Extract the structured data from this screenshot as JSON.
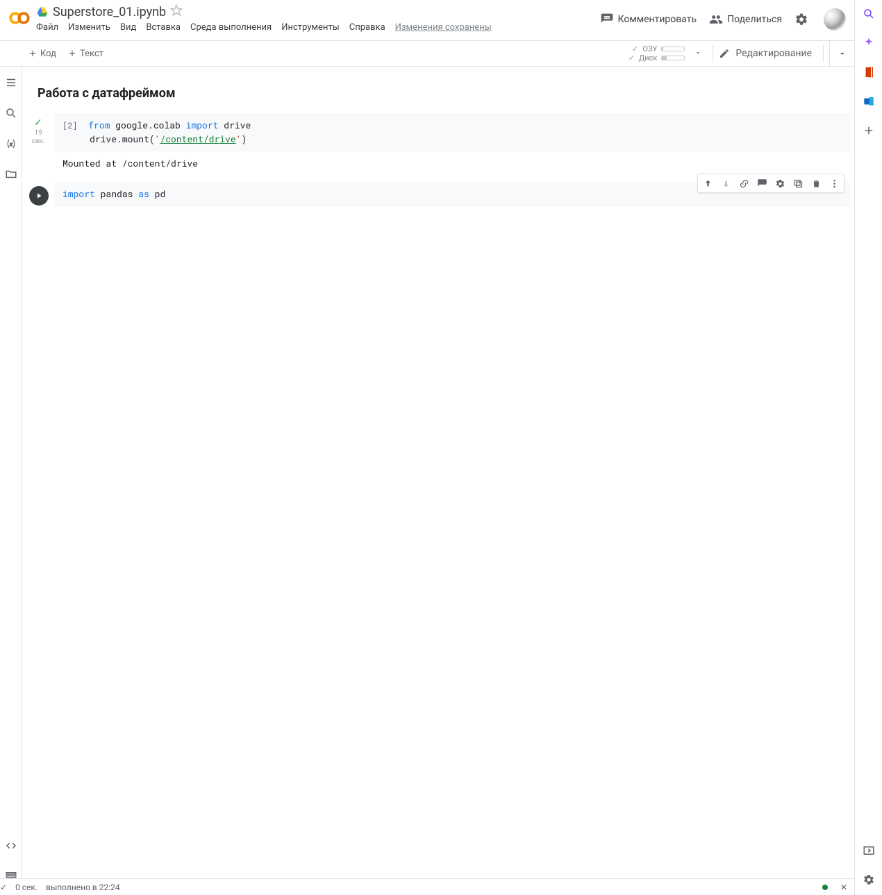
{
  "header": {
    "title": "Superstore_01.ipynb",
    "menus": [
      "Файл",
      "Изменить",
      "Вид",
      "Вставка",
      "Среда выполнения",
      "Инструменты",
      "Справка"
    ],
    "save_status": "Изменения сохранены",
    "comment_label": "Комментировать",
    "share_label": "Поделиться"
  },
  "toolbar": {
    "add_code": "Код",
    "add_text": "Текст",
    "ram_label": "ОЗУ",
    "disk_label": "Диск",
    "edit_label": "Редактирование"
  },
  "notebook": {
    "heading": "Работа с датафреймом",
    "cell1": {
      "index": "[2]",
      "exec_time": "19",
      "exec_unit": "сек.",
      "code_tokens": {
        "from_kw": "from",
        "mod": " google.colab ",
        "import_kw": "import",
        "drive": " drive",
        "line2a": "drive.mount(",
        "str_q1": "'",
        "str_body": "/content/drive",
        "str_q2": "'",
        "line2b": ")"
      },
      "output": "Mounted at /content/drive"
    },
    "cell2": {
      "code_tokens": {
        "import_kw": "import",
        "pandas": " pandas ",
        "as_kw": "as",
        "pd": " pd"
      }
    }
  },
  "statusbar": {
    "check": "✓",
    "elapsed": "0 сек.",
    "finished": "выполнено в 22:24"
  }
}
